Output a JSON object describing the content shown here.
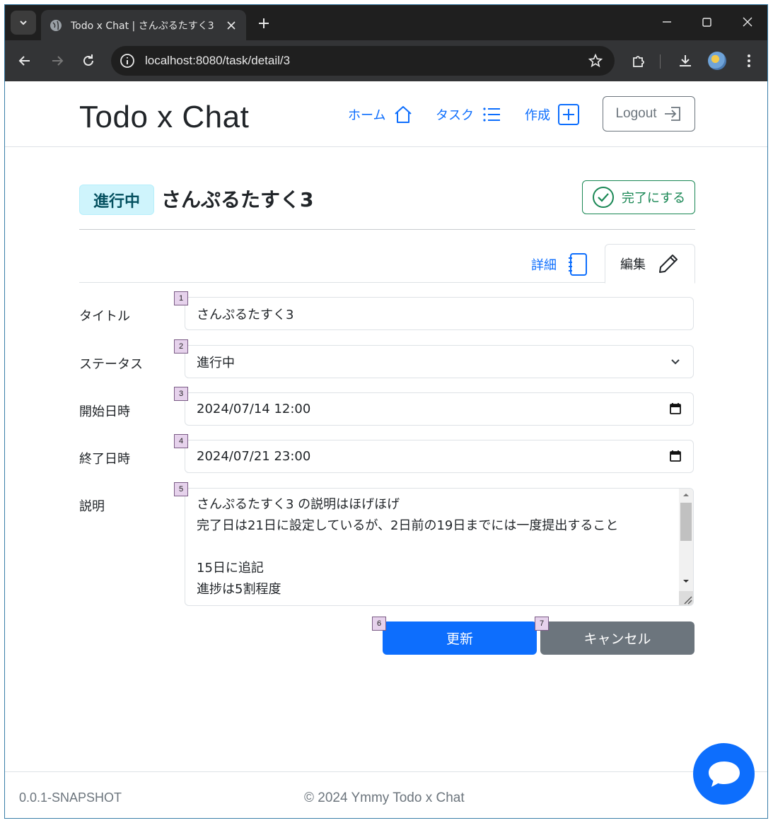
{
  "browser": {
    "tab_title": "Todo x Chat | さんぷるたすく3",
    "url": "localhost:8080/task/detail/3"
  },
  "navbar": {
    "brand": "Todo x Chat",
    "links": [
      {
        "label": "ホーム",
        "icon": "house-icon"
      },
      {
        "label": "タスク",
        "icon": "list-icon"
      },
      {
        "label": "作成",
        "icon": "plus-square-icon"
      }
    ],
    "logout_label": "Logout"
  },
  "task": {
    "status_badge": "進行中",
    "title": "さんぷるたすく3",
    "complete_label": "完了にする"
  },
  "tabs": {
    "detail": "詳細",
    "edit": "編集"
  },
  "form": {
    "title_label": "タイトル",
    "title_value": "さんぷるたすく3",
    "status_label": "ステータス",
    "status_value": "進行中",
    "start_label": "開始日時",
    "start_value": "2024/07/14 12:00",
    "end_label": "終了日時",
    "end_value": "2024/07/21 23:00",
    "description_label": "説明",
    "description_lines": [
      "さんぷるたすく3 の説明はほげほげ",
      "完了日は21日に設定しているが、2日前の19日までには一度提出すること",
      "",
      "15日に追記",
      "進捗は5割程度"
    ],
    "update_label": "更新",
    "cancel_label": "キャンセル"
  },
  "markers": [
    "1",
    "2",
    "3",
    "4",
    "5",
    "6",
    "7"
  ],
  "footer": {
    "version": "0.0.1-SNAPSHOT",
    "copyright": "© 2024 Ymmy Todo x Chat"
  },
  "colors": {
    "primary": "#0d6efd",
    "success": "#198754",
    "secondary": "#6c757d",
    "info_bg": "#cff4fc"
  }
}
